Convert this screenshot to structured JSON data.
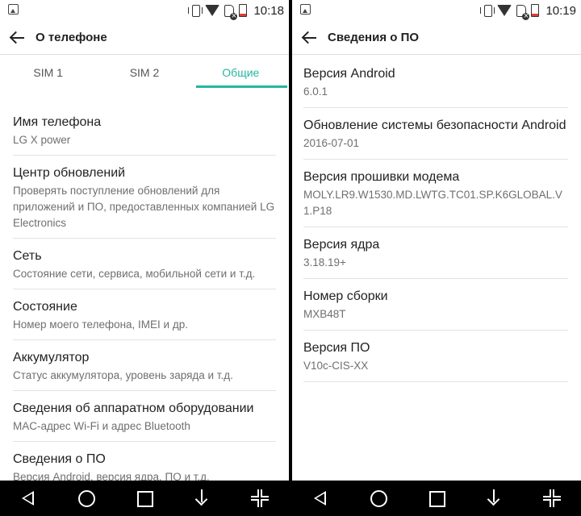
{
  "left": {
    "status": {
      "time": "10:18",
      "battery_level": 0.25,
      "battery_color": "#e53935"
    },
    "title": "О телефоне",
    "tabs": [
      {
        "label": "SIM 1",
        "active": false
      },
      {
        "label": "SIM 2",
        "active": false
      },
      {
        "label": "Общие",
        "active": true
      }
    ],
    "items": [
      {
        "title": "Имя телефона",
        "subtitle": "LG X power"
      },
      {
        "title": "Центр обновлений",
        "subtitle": "Проверять поступление обновлений для приложений и ПО, предоставленных компанией LG Electronics"
      },
      {
        "title": "Сеть",
        "subtitle": "Состояние сети, сервиса, мобильной сети и т.д."
      },
      {
        "title": "Состояние",
        "subtitle": "Номер моего телефона, IMEI и др."
      },
      {
        "title": "Аккумулятор",
        "subtitle": "Статус аккумулятора, уровень заряда и т.д."
      },
      {
        "title": "Сведения об аппаратном оборудовании",
        "subtitle": "MAC-адрес Wi-Fi и адрес Bluetooth"
      },
      {
        "title": "Сведения о ПО",
        "subtitle": "Версия Android, версия ядра, ПО и т.д."
      }
    ]
  },
  "right": {
    "status": {
      "time": "10:19",
      "battery_level": 0.25,
      "battery_color": "#e53935"
    },
    "title": "Сведения о ПО",
    "items": [
      {
        "title": "Версия Android",
        "subtitle": "6.0.1"
      },
      {
        "title": "Обновление системы безопасности Android",
        "subtitle": "2016-07-01"
      },
      {
        "title": "Версия прошивки модема",
        "subtitle": "MOLY.LR9.W1530.MD.LWTG.TC01.SP.K6GLOBAL.V1.P18"
      },
      {
        "title": "Версия ядра",
        "subtitle": "3.18.19+"
      },
      {
        "title": "Номер сборки",
        "subtitle": "MXB48T"
      },
      {
        "title": "Версия ПО",
        "subtitle": "V10c-CIS-XX"
      }
    ]
  },
  "theme": {
    "accent": "#26b5a0"
  }
}
